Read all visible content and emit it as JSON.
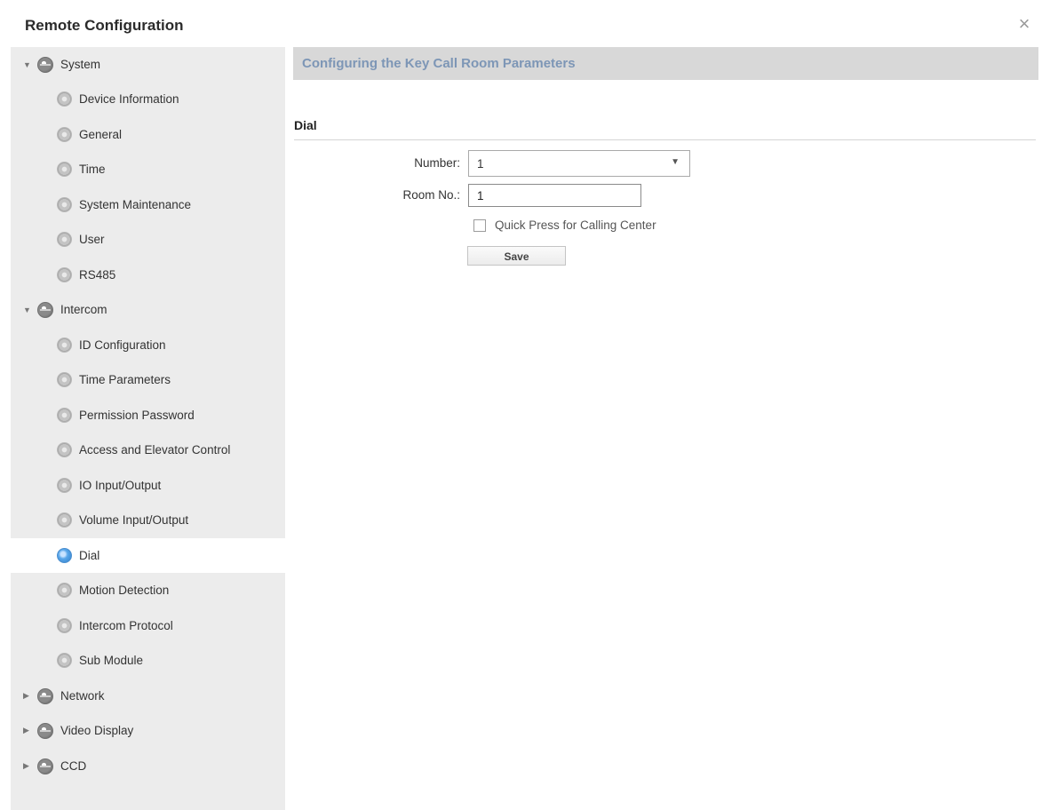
{
  "window": {
    "title": "Remote Configuration",
    "close_icon": "close-icon"
  },
  "sidebar": {
    "categories": [
      {
        "label": "System",
        "expanded": true,
        "items": [
          "Device Information",
          "General",
          "Time",
          "System Maintenance",
          "User",
          "RS485"
        ]
      },
      {
        "label": "Intercom",
        "expanded": true,
        "items": [
          "ID Configuration",
          "Time Parameters",
          "Permission Password",
          "Access and Elevator Control",
          "IO Input/Output",
          "Volume Input/Output",
          "Dial",
          "Motion Detection",
          "Intercom Protocol",
          "Sub Module"
        ]
      },
      {
        "label": "Network",
        "expanded": false,
        "items": []
      },
      {
        "label": "Video Display",
        "expanded": false,
        "items": []
      },
      {
        "label": "CCD",
        "expanded": false,
        "items": []
      }
    ],
    "selected": "Dial"
  },
  "main": {
    "page_title": "Configuring the Key Call Room Parameters",
    "section_title": "Dial",
    "number_label": "Number:",
    "number_value": "1",
    "room_label": "Room No.:",
    "room_value": "1",
    "quick_press_label": "Quick Press for Calling Center",
    "quick_press_checked": false,
    "save_label": "Save"
  },
  "colors": {
    "sidebar_bg": "#ececec",
    "header_bg": "#d8d8d8",
    "header_text": "#7d96b6",
    "selected_bg": "#ffffff"
  }
}
